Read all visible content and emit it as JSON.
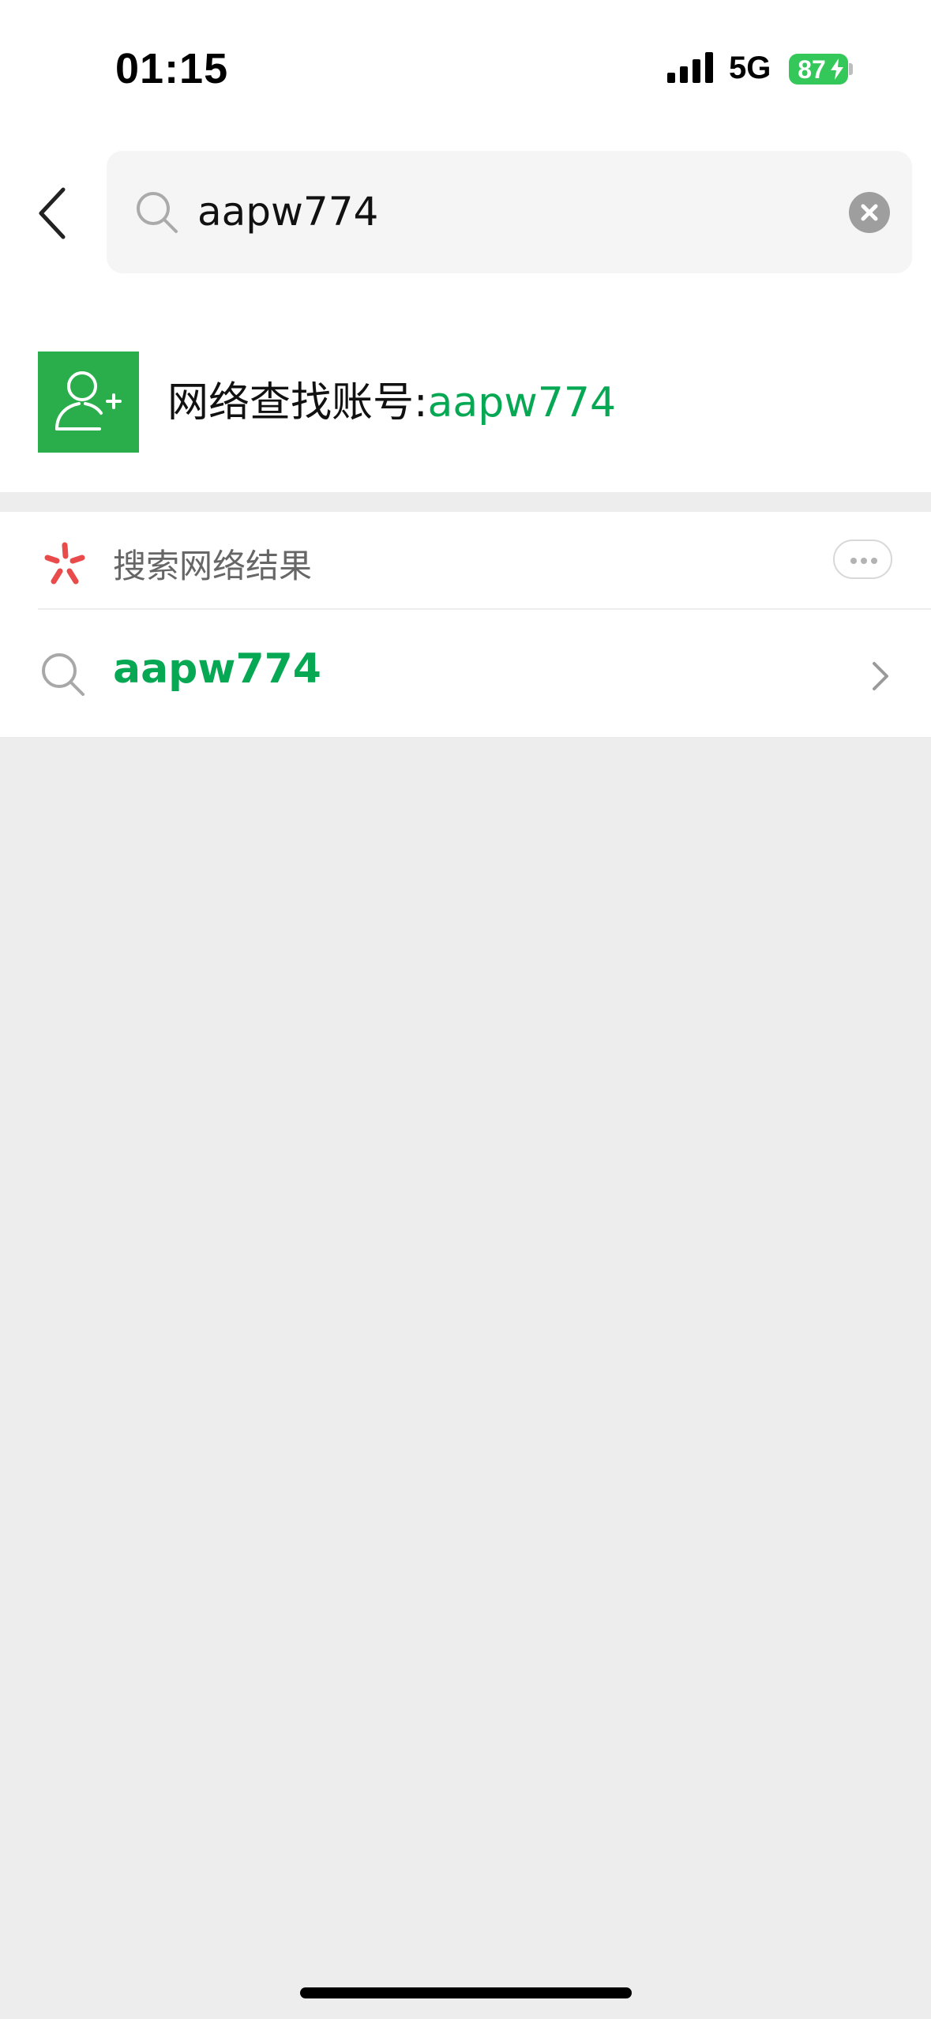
{
  "status_bar": {
    "time": "01:15",
    "network": "5G",
    "battery": "87",
    "battery_color": "#34c759"
  },
  "search": {
    "query": "aapw774",
    "icon": "search-icon",
    "clear_icon": "clear-icon"
  },
  "find_account": {
    "label": "网络查找账号:",
    "keyword": "aapw774",
    "icon": "add-user-icon",
    "icon_bg": "#2aae4b"
  },
  "web_search": {
    "title": "搜索网络结果",
    "logo": "search-logo-icon",
    "more_icon": "more-icon",
    "result_text": "aapw774",
    "result_icon": "search-icon",
    "arrow_icon": "chevron-right-icon"
  },
  "colors": {
    "accent": "#07a854",
    "background": "#ededed"
  }
}
